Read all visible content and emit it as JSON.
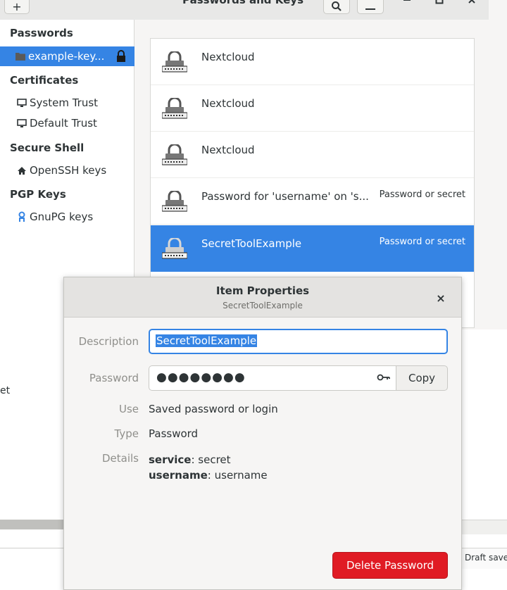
{
  "window": {
    "title": "Passwords and Keys"
  },
  "sidebar": {
    "sections": [
      {
        "heading": "Passwords",
        "items": [
          {
            "label": "example-key...",
            "selected": true
          }
        ]
      },
      {
        "heading": "Certificates",
        "items": [
          {
            "label": "System Trust"
          },
          {
            "label": "Default Trust"
          }
        ]
      },
      {
        "heading": "Secure Shell",
        "items": [
          {
            "label": "OpenSSH keys"
          }
        ]
      },
      {
        "heading": "PGP Keys",
        "items": [
          {
            "label": "GnuPG keys"
          }
        ]
      }
    ]
  },
  "list": {
    "rows": [
      {
        "name": "Nextcloud",
        "type": ""
      },
      {
        "name": "Nextcloud",
        "type": ""
      },
      {
        "name": "Nextcloud",
        "type": ""
      },
      {
        "name": "Password for 'username' on 's...",
        "type": "Password or secret"
      },
      {
        "name": "SecretToolExample",
        "type": "Password or secret",
        "selected": true
      }
    ]
  },
  "dialog": {
    "title": "Item Properties",
    "subtitle": "SecretToolExample",
    "close_glyph": "×",
    "description_label": "Description",
    "description_value": "SecretToolExample",
    "password_label": "Password",
    "password_mask": "●●●●●●●●",
    "copy_label": "Copy",
    "use_label": "Use",
    "use_value": "Saved password or login",
    "type_label": "Type",
    "type_value": "Password",
    "details_label": "Details",
    "details": [
      {
        "key": "service",
        "value": ": secret"
      },
      {
        "key": "username",
        "value": ": username"
      }
    ],
    "delete_label": "Delete Password"
  },
  "background": {
    "left_text": "et",
    "status_text": "Draft save"
  },
  "colors": {
    "accent": "#3584e4",
    "destructive": "#e01b24"
  }
}
